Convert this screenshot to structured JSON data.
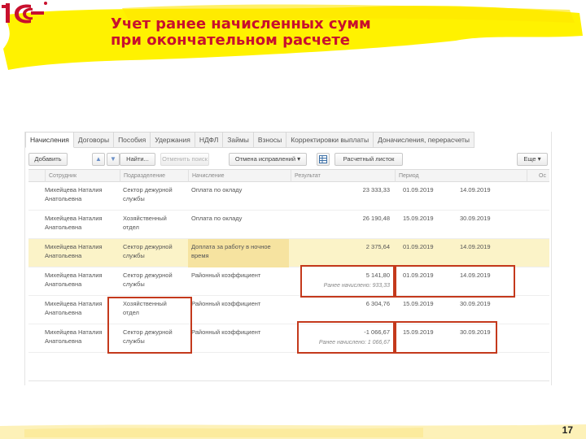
{
  "slide": {
    "title_line1": "Учет ранее начисленных сумм",
    "title_line2": "при окончательном расчете",
    "page_number": "17",
    "logo_text": "1С",
    "colors": {
      "highlight": "#fff200",
      "title": "#c8102e",
      "callout": "#c4391c"
    }
  },
  "tabs": [
    {
      "label": "Начисления",
      "active": true
    },
    {
      "label": "Договоры"
    },
    {
      "label": "Пособия"
    },
    {
      "label": "Удержания"
    },
    {
      "label": "НДФЛ"
    },
    {
      "label": "Займы"
    },
    {
      "label": "Взносы"
    },
    {
      "label": "Корректировки выплаты"
    },
    {
      "label": "Доначисления, перерасчеты"
    }
  ],
  "toolbar": {
    "add": "Добавить",
    "up_icon": "arrow-up-icon",
    "down_icon": "arrow-down-icon",
    "find": "Найти...",
    "cancel_search": "Отменить поиск",
    "corrections": "Отмена исправлений",
    "sheet_icon": "spreadsheet-icon",
    "payslip": "Расчетный листок",
    "more": "Еще"
  },
  "columns": {
    "employee": "Сотрудник",
    "department": "Подразделение",
    "accrual": "Начисление",
    "result": "Результат",
    "period": "Период",
    "extra": "Ос"
  },
  "rows": [
    {
      "employee_1": "Михейцева Наталия",
      "employee_2": "Анатольевна",
      "dept_1": "Сектор дежурной",
      "dept_2": "службы",
      "accrual_1": "Оплата по окладу",
      "accrual_2": "",
      "result": "23 333,33",
      "note": "",
      "from": "01.09.2019",
      "to": "14.09.2019"
    },
    {
      "employee_1": "Михейцева Наталия",
      "employee_2": "Анатольевна",
      "dept_1": "Хозяйственный",
      "dept_2": "отдел",
      "accrual_1": "Оплата по окладу",
      "accrual_2": "",
      "result": "26 190,48",
      "note": "",
      "from": "15.09.2019",
      "to": "30.09.2019"
    },
    {
      "employee_1": "Михейцева Наталия",
      "employee_2": "Анатольевна",
      "dept_1": "Сектор дежурной",
      "dept_2": "службы",
      "accrual_1": "Доплата за работу в ночное",
      "accrual_2": "время",
      "result": "2 375,64",
      "note": "",
      "from": "01.09.2019",
      "to": "14.09.2019",
      "selected": true
    },
    {
      "employee_1": "Михейцева Наталия",
      "employee_2": "Анатольевна",
      "dept_1": "Сектор дежурной",
      "dept_2": "службы",
      "accrual_1": "Районный коэффициент",
      "accrual_2": "",
      "result": "5 141,80",
      "note": "Ранее начислено: 933,33",
      "from": "01.09.2019",
      "to": "14.09.2019"
    },
    {
      "employee_1": "Михейцева Наталия",
      "employee_2": "Анатольевна",
      "dept_1": "Хозяйственный",
      "dept_2": "отдел",
      "accrual_1": "Районный коэффициент",
      "accrual_2": "",
      "result": "6 304,76",
      "note": "",
      "from": "15.09.2019",
      "to": "30.09.2019"
    },
    {
      "employee_1": "Михейцева Наталия",
      "employee_2": "Анатольевна",
      "dept_1": "Сектор дежурной",
      "dept_2": "службы",
      "accrual_1": "Районный коэффициент",
      "accrual_2": "",
      "result": "-1 066,67",
      "note": "Ранее начислено: 1 066,67",
      "from": "15.09.2019",
      "to": "30.09.2019"
    }
  ]
}
